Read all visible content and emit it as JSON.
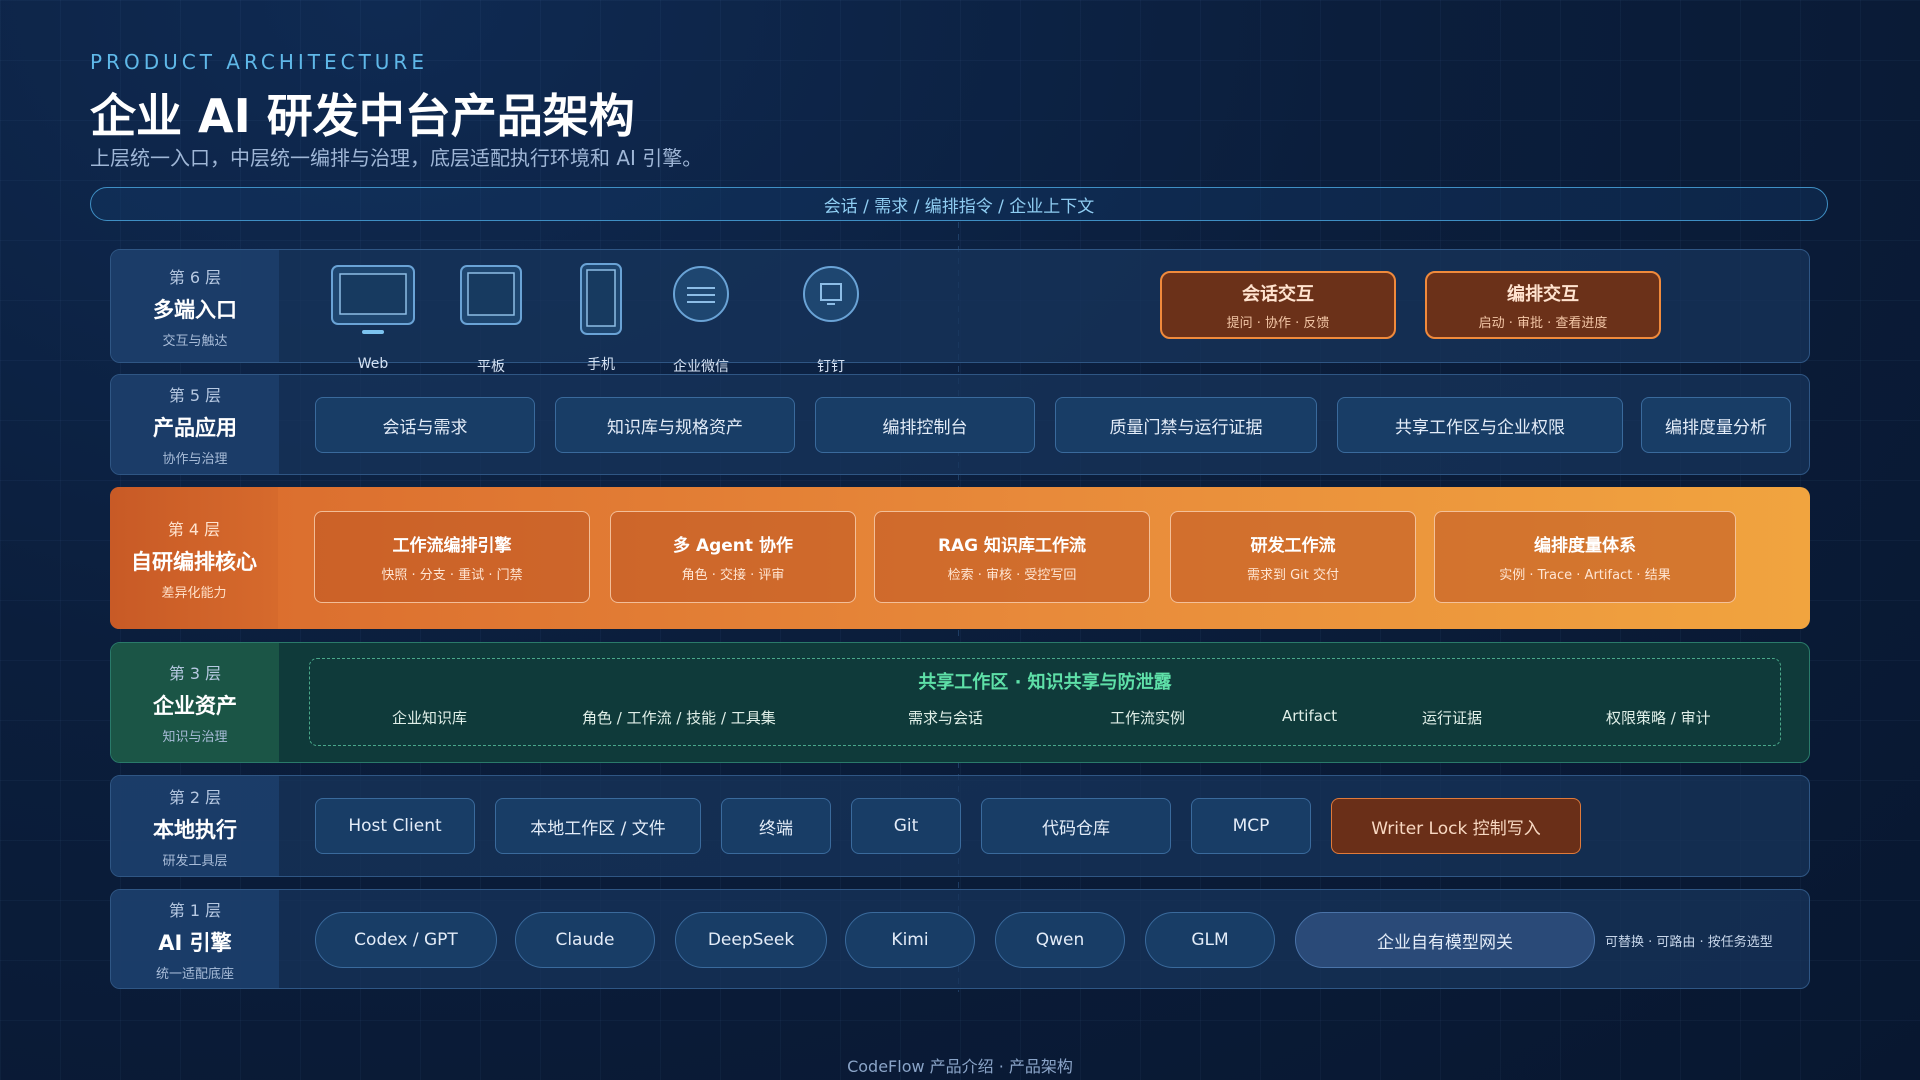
{
  "header": {
    "eyebrow": "PRODUCT ARCHITECTURE",
    "title": "企业 AI 研发中台产品架构",
    "subtitle": "上层统一入口，中层统一编排与治理，底层适配执行环境和 AI 引擎。"
  },
  "context_bar": "会话 / 需求 / 编排指令 / 企业上下文",
  "layer6": {
    "num": "第 6 层",
    "name": "多端入口",
    "desc": "交互与触达",
    "devices": [
      {
        "label": "Web",
        "icon": "monitor-icon"
      },
      {
        "label": "平板",
        "icon": "tablet-icon"
      },
      {
        "label": "手机",
        "icon": "phone-icon"
      },
      {
        "label": "企业微信",
        "icon": "wecom-icon"
      },
      {
        "label": "钉钉",
        "icon": "dingtalk-icon"
      }
    ],
    "highlights": [
      {
        "title": "会话交互",
        "sub": "提问 · 协作 · 反馈"
      },
      {
        "title": "编排交互",
        "sub": "启动 · 审批 · 查看进度"
      }
    ]
  },
  "layer5": {
    "num": "第 5 层",
    "name": "产品应用",
    "desc": "协作与治理",
    "items": [
      "会话与需求",
      "知识库与规格资产",
      "编排控制台",
      "质量门禁与运行证据",
      "共享工作区与企业权限",
      "编排度量分析"
    ]
  },
  "layer4": {
    "num": "第 4 层",
    "name": "自研编排核心",
    "desc": "差异化能力",
    "items": [
      {
        "title": "工作流编排引擎",
        "sub": "快照 · 分支 · 重试 · 门禁"
      },
      {
        "title": "多 Agent 协作",
        "sub": "角色 · 交接 · 评审"
      },
      {
        "title": "RAG 知识库工作流",
        "sub": "检索 · 审核 · 受控写回"
      },
      {
        "title": "研发工作流",
        "sub": "需求到 Git 交付"
      },
      {
        "title": "编排度量体系",
        "sub": "实例 · Trace · Artifact · 结果"
      }
    ]
  },
  "layer3": {
    "num": "第 3 层",
    "name": "企业资产",
    "desc": "知识与治理",
    "title": "共享工作区 · 知识共享与防泄露",
    "items": [
      "企业知识库",
      "角色 / 工作流 / 技能 / 工具集",
      "需求与会话",
      "工作流实例",
      "Artifact",
      "运行证据",
      "权限策略 / 审计"
    ]
  },
  "layer2": {
    "num": "第 2 层",
    "name": "本地执行",
    "desc": "研发工具层",
    "items": [
      "Host Client",
      "本地工作区 / 文件",
      "终端",
      "Git",
      "代码仓库",
      "MCP",
      "Writer Lock 控制写入"
    ]
  },
  "layer1": {
    "num": "第 1 层",
    "name": "AI 引擎",
    "desc": "统一适配底座",
    "items": [
      "Codex / GPT",
      "Claude",
      "DeepSeek",
      "Kimi",
      "Qwen",
      "GLM",
      "企业自有模型网关"
    ],
    "note": "可替换 · 可路由 · 按任务选型"
  },
  "footer": "CodeFlow 产品介绍 · 产品架构",
  "colors": {
    "accent_orange": "#e88a3a",
    "accent_green": "#5ee0a8",
    "accent_blue": "#5fb8e8"
  }
}
